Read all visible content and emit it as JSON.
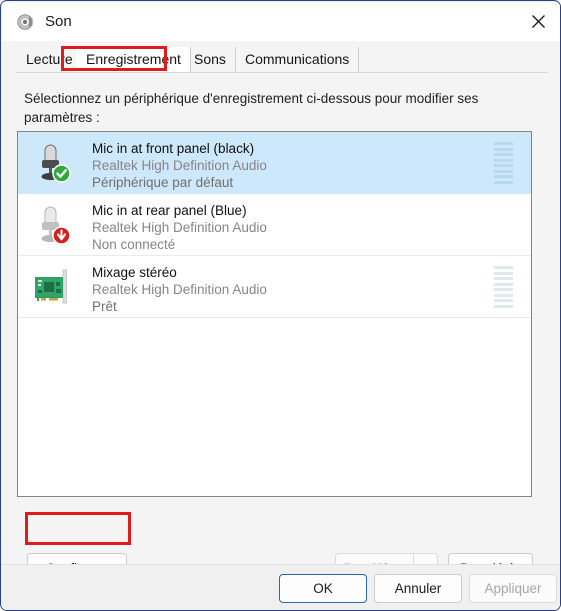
{
  "window": {
    "title": "Son",
    "app_icon": "speaker-icon",
    "close_label": "✕"
  },
  "tabs": [
    {
      "label": "Lecture",
      "selected": false
    },
    {
      "label": "Enregistrement",
      "selected": true
    },
    {
      "label": "Sons",
      "selected": false
    },
    {
      "label": "Communications",
      "selected": false
    }
  ],
  "instruction": "Sélectionnez un périphérique d'enregistrement ci-dessous pour modifier ses paramètres :",
  "devices": [
    {
      "name": "Mic in at front panel (black)",
      "driver": "Realtek High Definition Audio",
      "status": "Périphérique par défaut",
      "icon": "microphone-icon",
      "badge": "green-check-badge",
      "selected": true,
      "meter": "active"
    },
    {
      "name": "Mic in at rear panel (Blue)",
      "driver": "Realtek High Definition Audio",
      "status": "Non connecté",
      "icon": "microphone-disabled-icon",
      "badge": "red-down-arrow-badge",
      "selected": false,
      "meter": "none"
    },
    {
      "name": "Mixage stéréo",
      "driver": "Realtek High Definition Audio",
      "status": "Prêt",
      "icon": "sound-card-icon",
      "badge": "none",
      "selected": false,
      "meter": "idle"
    }
  ],
  "buttons": {
    "configure": "Configurer",
    "set_default": "Par défaut",
    "properties": "Propriétés",
    "ok": "OK",
    "cancel": "Annuler",
    "apply": "Appliquer"
  },
  "annotations": {
    "color": "#e01b1b",
    "targets": [
      "Enregistrement",
      "Configurer"
    ]
  }
}
